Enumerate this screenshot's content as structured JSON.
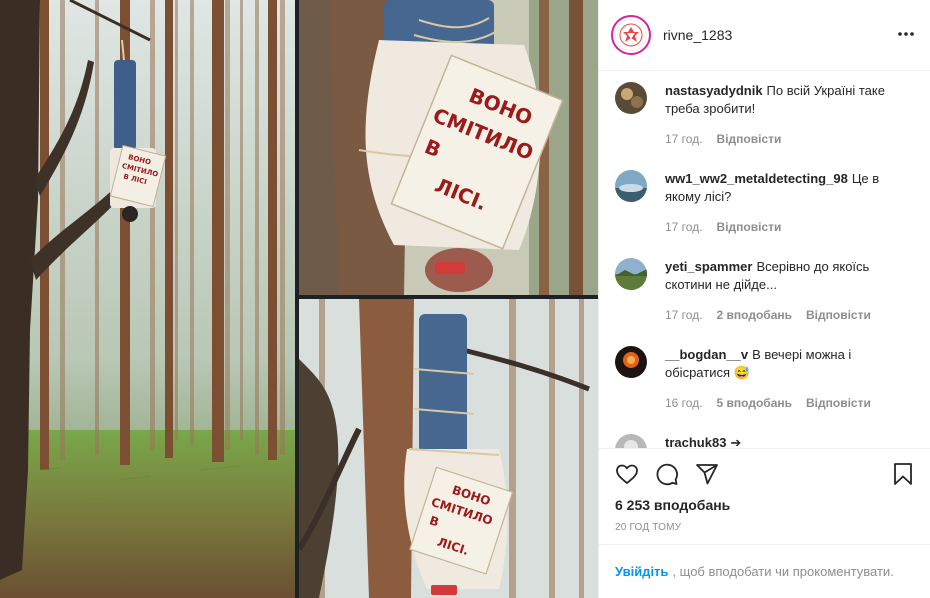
{
  "post": {
    "owner": "rivne_1283",
    "sign_lines": [
      "ВОНО",
      "СМІТИЛО",
      "В",
      "ЛІСІ."
    ]
  },
  "header": {
    "more_icon": "more-horizontal-icon"
  },
  "comments": [
    {
      "user": "nastasyadydnik",
      "text": "По всій Україні таке треба зробити!",
      "age": "17 год.",
      "likes": "",
      "reply": "Відповісти"
    },
    {
      "user": "ww1_ww2_metaldetecting_98",
      "text": "Це в якому лісі?",
      "age": "17 год.",
      "likes": "",
      "reply": "Відповісти"
    },
    {
      "user": "yeti_spammer",
      "text": "Всерівно до якоїсь скотини не дійде...",
      "age": "17 год.",
      "likes": "2 вподобань",
      "reply": "Відповісти"
    },
    {
      "user": "__bogdan__v",
      "text": "В вечері можна і обісратися 😅",
      "age": "16 год.",
      "likes": "5 вподобань",
      "reply": "Відповісти"
    },
    {
      "user": "trachuk83",
      "text": "➔",
      "age": "",
      "likes": "",
      "reply": ""
    }
  ],
  "actions": {
    "like_icon": "heart-icon",
    "comment_icon": "comment-icon",
    "share_icon": "paper-plane-icon",
    "save_icon": "bookmark-icon"
  },
  "likes_count": "6 253 вподобань",
  "posted_ago": "20 ГОД ТОМУ",
  "login": {
    "link": "Увійдіть",
    "text": ", щоб вподобати чи прокоментувати."
  },
  "colors": {
    "link_blue": "#0095f6",
    "meta_gray": "#8e8e8e",
    "story_ring": "#d6249f",
    "sign_red": "#9b1b1b"
  }
}
